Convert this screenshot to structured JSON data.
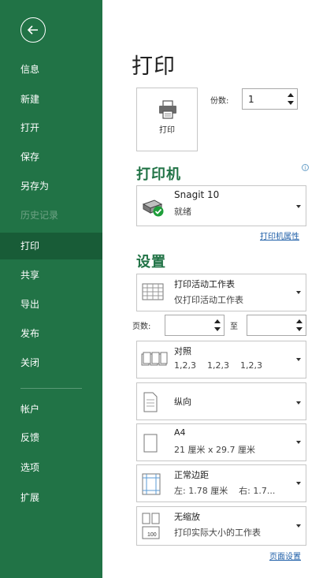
{
  "sidebar": {
    "items": [
      {
        "label": "信息",
        "state": "normal"
      },
      {
        "label": "新建",
        "state": "normal"
      },
      {
        "label": "打开",
        "state": "normal"
      },
      {
        "label": "保存",
        "state": "normal"
      },
      {
        "label": "另存为",
        "state": "normal"
      },
      {
        "label": "历史记录",
        "state": "disabled"
      },
      {
        "label": "打印",
        "state": "active"
      },
      {
        "label": "共享",
        "state": "normal"
      },
      {
        "label": "导出",
        "state": "normal"
      },
      {
        "label": "发布",
        "state": "normal"
      },
      {
        "label": "关闭",
        "state": "normal"
      },
      {
        "label": "帐户",
        "state": "normal"
      },
      {
        "label": "反馈",
        "state": "normal"
      },
      {
        "label": "选项",
        "state": "normal"
      },
      {
        "label": "扩展",
        "state": "normal"
      }
    ]
  },
  "main": {
    "title": "打印",
    "print_button_label": "打印",
    "copies_label": "份数:",
    "copies_value": "1",
    "printer_section": {
      "title": "打印机",
      "printer_name": "Snagit 10",
      "printer_status": "就绪",
      "properties_link": "打印机属性"
    },
    "settings_section": {
      "title": "设置",
      "print_what": {
        "title": "打印活动工作表",
        "subtitle": "仅打印活动工作表"
      },
      "pages_label": "页数:",
      "pages_to_label": "至",
      "collate": {
        "title": "对照",
        "subtitle": "1,2,3    1,2,3    1,2,3"
      },
      "orientation": {
        "title": "纵向"
      },
      "paper": {
        "title": "A4",
        "subtitle": "21 厘米 x 29.7 厘米"
      },
      "margins": {
        "title": "正常边距",
        "subtitle": "左: 1.78 厘米    右: 1.7..."
      },
      "scaling": {
        "title": "无缩放",
        "subtitle": "打印实际大小的工作表",
        "icon_text": "100"
      },
      "page_setup_link": "页面设置"
    }
  },
  "colors": {
    "brand": "#217346",
    "active": "#185c37",
    "link": "#1f5fa8"
  }
}
